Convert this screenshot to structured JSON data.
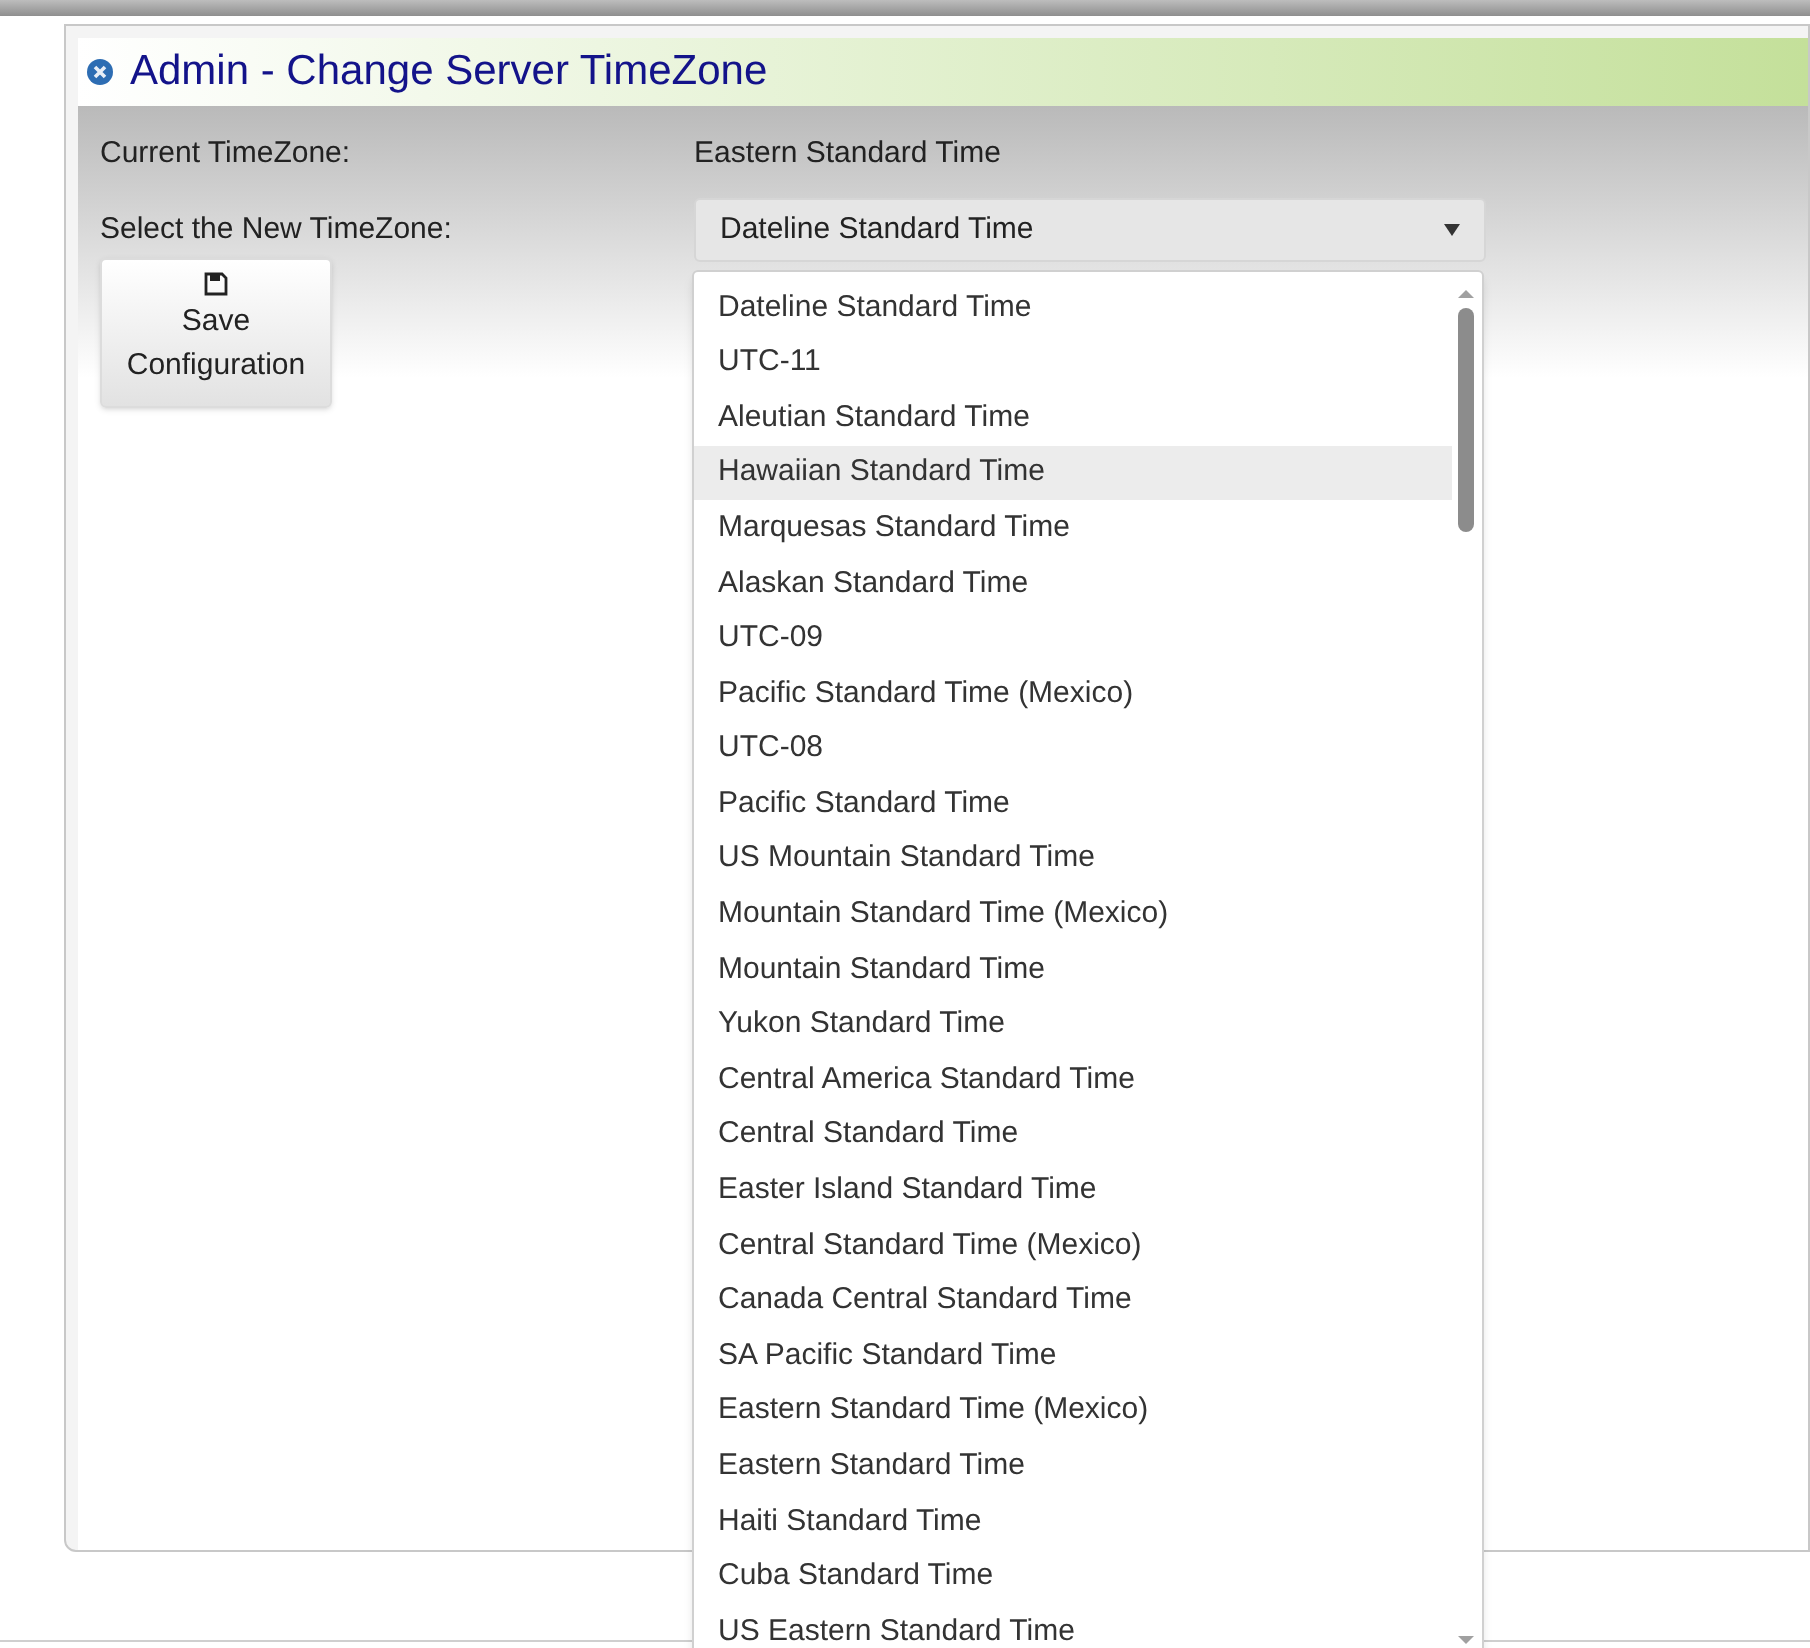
{
  "panel": {
    "title": "Admin - Change Server TimeZone"
  },
  "form": {
    "current_label": "Current TimeZone:",
    "current_value": "Eastern Standard Time",
    "select_label": "Select the New TimeZone:",
    "select_value": "Dateline Standard Time",
    "save_button": "Save Configuration"
  },
  "dropdown": {
    "open": true,
    "items": [
      {
        "label": "Dateline Standard Time",
        "highlighted": false
      },
      {
        "label": "UTC-11",
        "highlighted": false
      },
      {
        "label": "Aleutian Standard Time",
        "highlighted": false
      },
      {
        "label": "Hawaiian Standard Time",
        "highlighted": true
      },
      {
        "label": "Marquesas Standard Time",
        "highlighted": false
      },
      {
        "label": "Alaskan Standard Time",
        "highlighted": false
      },
      {
        "label": "UTC-09",
        "highlighted": false
      },
      {
        "label": "Pacific Standard Time (Mexico)",
        "highlighted": false
      },
      {
        "label": "UTC-08",
        "highlighted": false
      },
      {
        "label": "Pacific Standard Time",
        "highlighted": false
      },
      {
        "label": "US Mountain Standard Time",
        "highlighted": false
      },
      {
        "label": "Mountain Standard Time (Mexico)",
        "highlighted": false
      },
      {
        "label": "Mountain Standard Time",
        "highlighted": false
      },
      {
        "label": "Yukon Standard Time",
        "highlighted": false
      },
      {
        "label": "Central America Standard Time",
        "highlighted": false
      },
      {
        "label": "Central Standard Time",
        "highlighted": false
      },
      {
        "label": "Easter Island Standard Time",
        "highlighted": false
      },
      {
        "label": "Central Standard Time (Mexico)",
        "highlighted": false
      },
      {
        "label": "Canada Central Standard Time",
        "highlighted": false
      },
      {
        "label": "SA Pacific Standard Time",
        "highlighted": false
      },
      {
        "label": "Eastern Standard Time (Mexico)",
        "highlighted": false
      },
      {
        "label": "Eastern Standard Time",
        "highlighted": false
      },
      {
        "label": "Haiti Standard Time",
        "highlighted": false
      },
      {
        "label": "Cuba Standard Time",
        "highlighted": false
      },
      {
        "label": "US Eastern Standard Time",
        "highlighted": false
      }
    ]
  }
}
